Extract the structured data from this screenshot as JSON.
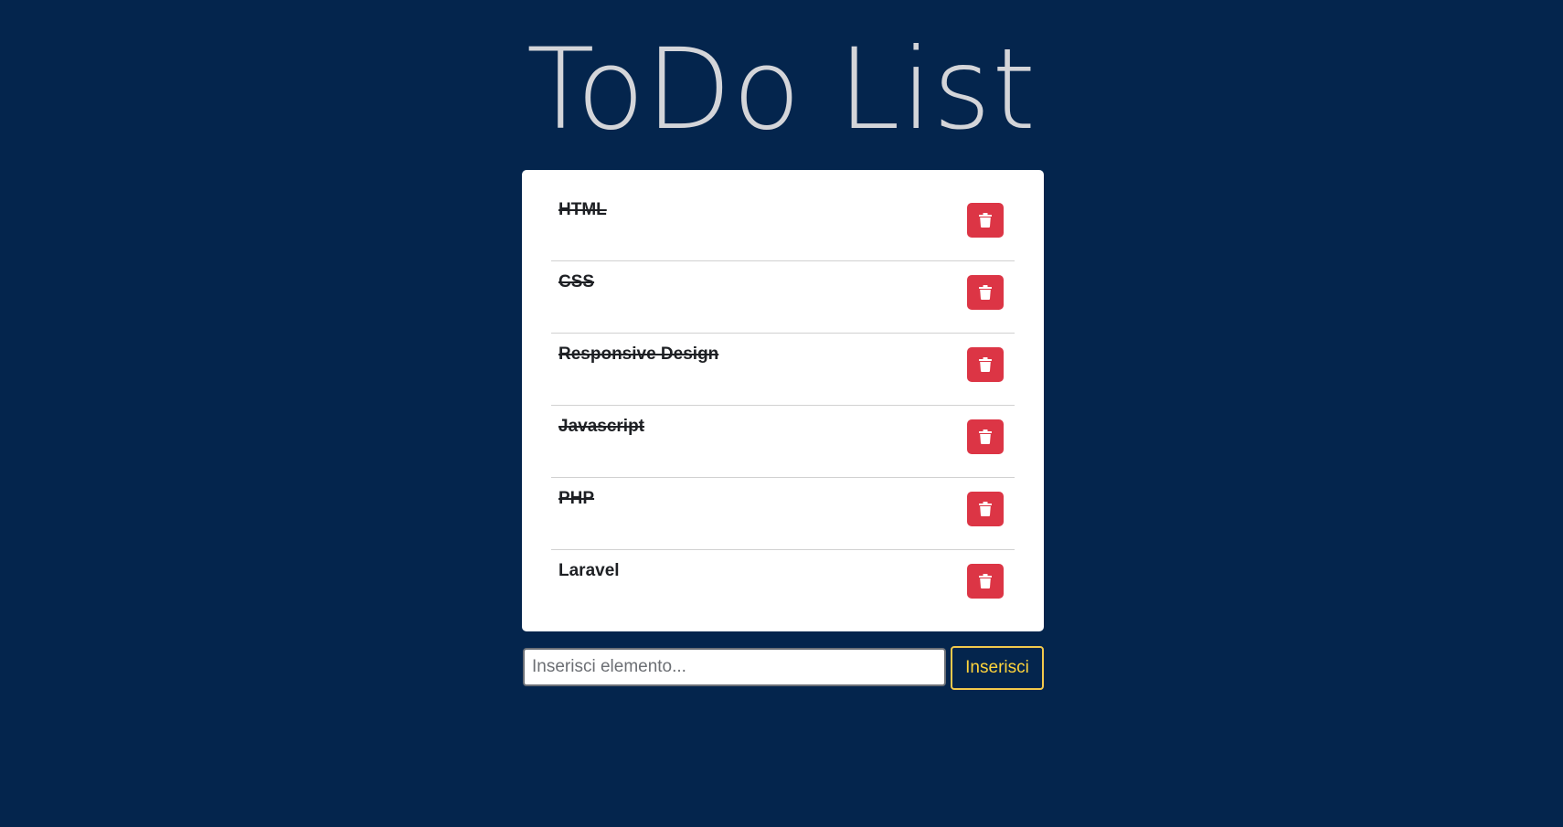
{
  "header": {
    "title": "ToDo List"
  },
  "todos": [
    {
      "text": "HTML",
      "done": true,
      "delete_icon": "trash-icon"
    },
    {
      "text": "CSS",
      "done": true,
      "delete_icon": "trash-icon"
    },
    {
      "text": "Responsive Design",
      "done": true,
      "delete_icon": "trash-icon"
    },
    {
      "text": "Javascript",
      "done": true,
      "delete_icon": "trash-icon"
    },
    {
      "text": "PHP",
      "done": true,
      "delete_icon": "trash-icon"
    },
    {
      "text": "Laravel",
      "done": false,
      "delete_icon": "trash-icon"
    }
  ],
  "new_item": {
    "value": "",
    "placeholder": "Inserisci elemento...",
    "button_label": "Inserisci"
  },
  "colors": {
    "background": "#04254d",
    "card": "#ffffff",
    "title": "#d4d5d9",
    "delete_button": "#dc3545",
    "add_button_border": "#f2c94c",
    "add_button_text": "#ffd43b"
  }
}
